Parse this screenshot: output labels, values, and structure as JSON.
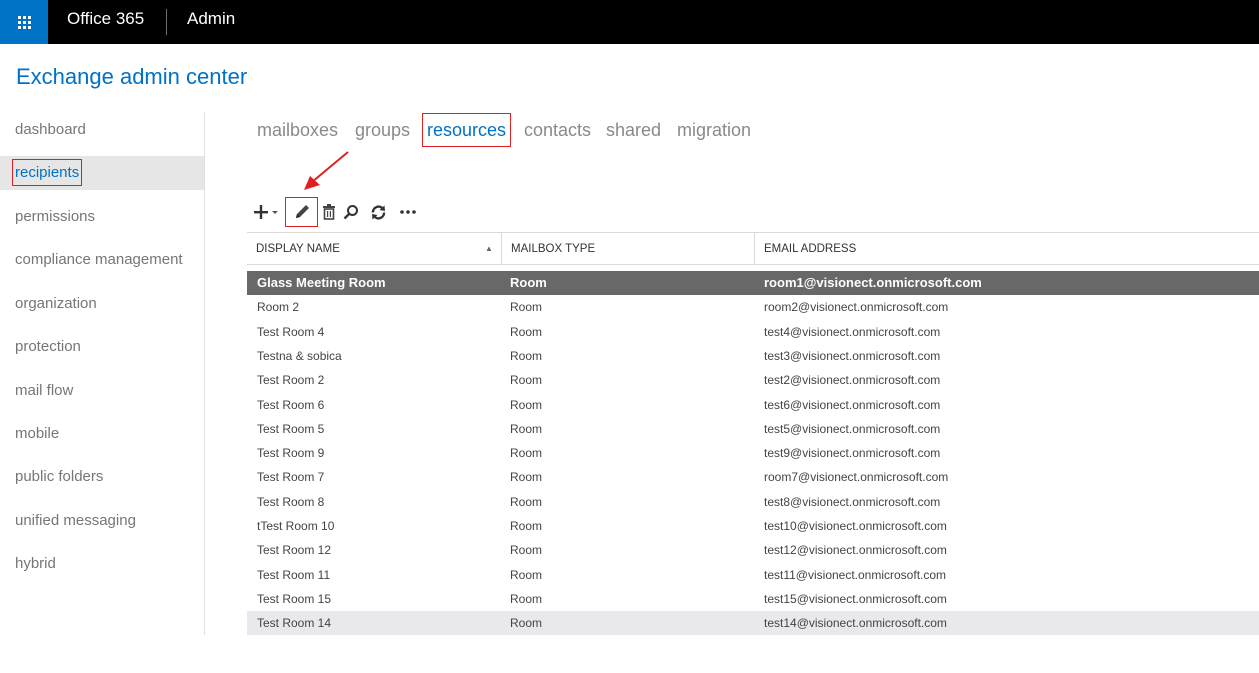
{
  "topbar": {
    "brand": "Office 365",
    "app": "Admin",
    "icons": {
      "launcher": "app-launcher-icon"
    }
  },
  "page": {
    "title": "Exchange admin center"
  },
  "sidebar": {
    "items": [
      {
        "label": "dashboard"
      },
      {
        "label": "recipients",
        "active": true
      },
      {
        "label": "permissions"
      },
      {
        "label": "compliance management"
      },
      {
        "label": "organization"
      },
      {
        "label": "protection"
      },
      {
        "label": "mail flow"
      },
      {
        "label": "mobile"
      },
      {
        "label": "public folders"
      },
      {
        "label": "unified messaging"
      },
      {
        "label": "hybrid"
      }
    ]
  },
  "tabs": [
    {
      "label": "mailboxes"
    },
    {
      "label": "groups"
    },
    {
      "label": "resources",
      "active": true
    },
    {
      "label": "contacts"
    },
    {
      "label": "shared"
    },
    {
      "label": "migration"
    }
  ],
  "toolbar": {
    "icons": [
      "add-icon",
      "edit-icon",
      "delete-icon",
      "search-icon",
      "refresh-icon",
      "more-icon"
    ]
  },
  "table": {
    "columns": [
      "DISPLAY NAME",
      "MAILBOX TYPE",
      "EMAIL ADDRESS"
    ],
    "sort": {
      "column": "DISPLAY NAME",
      "direction": "ascending"
    },
    "rows": [
      {
        "name": "Glass Meeting Room",
        "type": "Room",
        "email": "room1@visionect.onmicrosoft.com",
        "selected": true
      },
      {
        "name": "Room 2",
        "type": "Room",
        "email": "room2@visionect.onmicrosoft.com"
      },
      {
        "name": "Test Room 4",
        "type": "Room",
        "email": "test4@visionect.onmicrosoft.com"
      },
      {
        "name": "Testna & sobica",
        "type": "Room",
        "email": "test3@visionect.onmicrosoft.com"
      },
      {
        "name": "Test Room 2",
        "type": "Room",
        "email": "test2@visionect.onmicrosoft.com"
      },
      {
        "name": "Test Room 6",
        "type": "Room",
        "email": "test6@visionect.onmicrosoft.com"
      },
      {
        "name": "Test Room 5",
        "type": "Room",
        "email": "test5@visionect.onmicrosoft.com"
      },
      {
        "name": "Test Room 9",
        "type": "Room",
        "email": "test9@visionect.onmicrosoft.com"
      },
      {
        "name": "Test Room 7",
        "type": "Room",
        "email": "room7@visionect.onmicrosoft.com"
      },
      {
        "name": "Test Room 8",
        "type": "Room",
        "email": "test8@visionect.onmicrosoft.com"
      },
      {
        "name": "tTest Room 10",
        "type": "Room",
        "email": "test10@visionect.onmicrosoft.com"
      },
      {
        "name": "Test Room 12",
        "type": "Room",
        "email": "test12@visionect.onmicrosoft.com"
      },
      {
        "name": "Test Room 11",
        "type": "Room",
        "email": "test11@visionect.onmicrosoft.com"
      },
      {
        "name": "Test Room 15",
        "type": "Room",
        "email": "test15@visionect.onmicrosoft.com"
      },
      {
        "name": "Test Room 14",
        "type": "Room",
        "email": "test14@visionect.onmicrosoft.com",
        "hover": true
      }
    ]
  },
  "colors": {
    "accent": "#0072c6",
    "annotation": "#e02020",
    "selected_row": "#686868",
    "topbar": "#000000"
  }
}
